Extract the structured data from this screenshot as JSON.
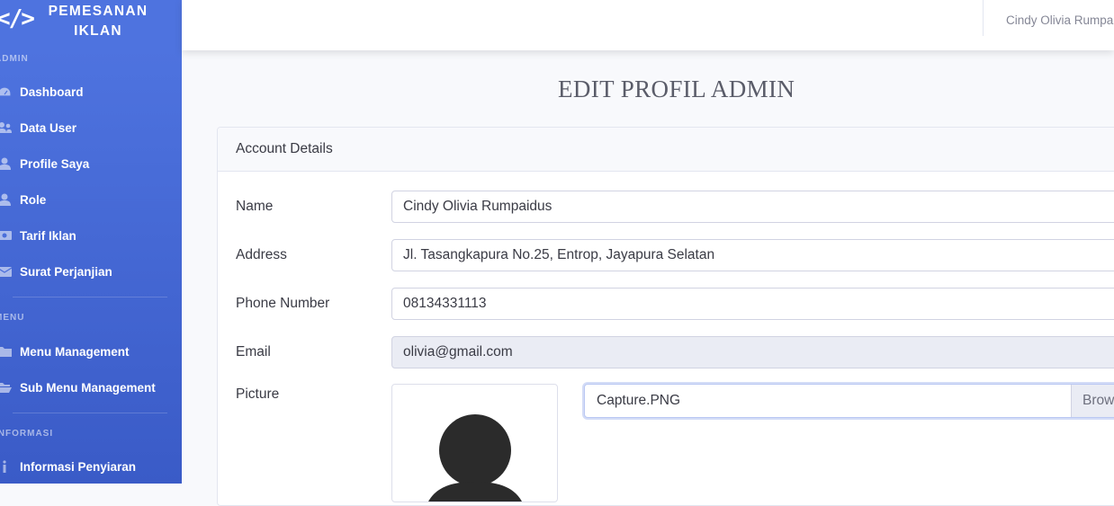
{
  "brand": {
    "title": "PEMESANAN IKLAN",
    "icon": "code-icon"
  },
  "sidebar": {
    "headings": [
      "ADMIN",
      "MENU",
      "INFORMASI"
    ],
    "items": [
      {
        "label": "Dashboard",
        "icon": "tachometer-icon"
      },
      {
        "label": "Data User",
        "icon": "users-icon"
      },
      {
        "label": "Profile Saya",
        "icon": "user-icon"
      },
      {
        "label": "Role",
        "icon": "user-tie-icon"
      },
      {
        "label": "Tarif Iklan",
        "icon": "money-icon"
      },
      {
        "label": "Surat Perjanjian",
        "icon": "envelope-icon"
      },
      {
        "label": "Menu Management",
        "icon": "folder-icon"
      },
      {
        "label": "Sub Menu Management",
        "icon": "folder-open-icon"
      },
      {
        "label": "Informasi Penyiaran",
        "icon": "info-icon"
      }
    ]
  },
  "topbar": {
    "user_name": "Cindy Olivia Rumpaidus"
  },
  "page": {
    "title": "EDIT PROFIL ADMIN"
  },
  "card": {
    "header": "Account Details",
    "fields": {
      "name": {
        "label": "Name",
        "value": "Cindy Olivia Rumpaidus"
      },
      "address": {
        "label": "Address",
        "value": "Jl. Tasangkapura No.25, Entrop, Jayapura Selatan"
      },
      "phone": {
        "label": "Phone Number",
        "value": "08134331113"
      },
      "email": {
        "label": "Email",
        "value": "olivia@gmail.com"
      },
      "picture": {
        "label": "Picture",
        "file_name": "Capture.PNG",
        "browse_label": "Browse"
      }
    }
  },
  "colors": {
    "sidebar": "#4e73df",
    "text": "#3a3b45",
    "muted": "#858796"
  }
}
